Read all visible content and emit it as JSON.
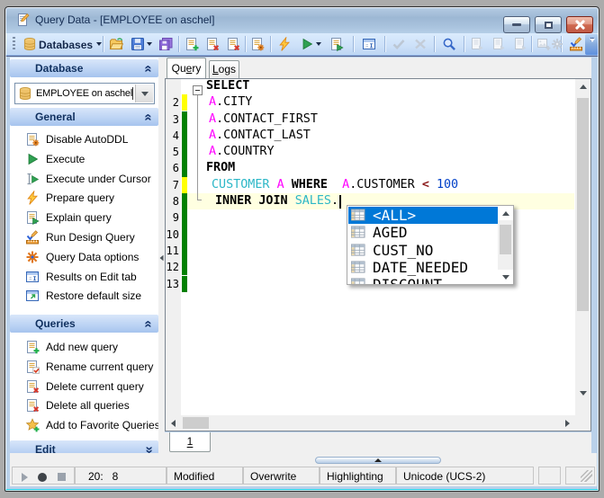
{
  "window": {
    "title": "Query Data - [EMPLOYEE on aschel]"
  },
  "toolbar": {
    "databases_label": "Databases",
    "items": [
      {
        "name": "databases-menu",
        "grayed": false
      },
      {
        "name": "open-query",
        "grayed": false
      },
      {
        "name": "save-query",
        "grayed": false
      },
      {
        "name": "save-all",
        "grayed": false
      },
      {
        "name": "new-query",
        "grayed": false
      },
      {
        "name": "delete-query",
        "grayed": false
      },
      {
        "name": "delete-all-queries",
        "grayed": false
      },
      {
        "name": "query-data-options",
        "grayed": false
      },
      {
        "name": "prepare-query",
        "grayed": false
      },
      {
        "name": "execute",
        "grayed": false
      },
      {
        "name": "explain-query",
        "grayed": false
      },
      {
        "name": "results-on-edit-tab",
        "grayed": false
      },
      {
        "name": "commit-transaction",
        "grayed": true
      },
      {
        "name": "rollback-transaction",
        "grayed": true
      },
      {
        "name": "find",
        "grayed": false
      },
      {
        "name": "export-data",
        "grayed": true
      },
      {
        "name": "export-as-insert",
        "grayed": true
      },
      {
        "name": "copy-results",
        "grayed": true
      },
      {
        "name": "add-image",
        "grayed": true
      },
      {
        "name": "settings",
        "grayed": true
      },
      {
        "name": "run-design-query",
        "grayed": false
      },
      {
        "name": "toolbar-overflow",
        "grayed": false
      }
    ]
  },
  "sidebar": {
    "groups": [
      {
        "title": "Database",
        "collapsed": false
      },
      {
        "title": "General",
        "collapsed": false
      },
      {
        "title": "Queries",
        "collapsed": false
      },
      {
        "title": "Edit",
        "collapsed": true
      }
    ],
    "database_combo": {
      "value": "EMPLOYEE on aschel"
    },
    "general_items": [
      {
        "icon": "doc-gear",
        "label": "Disable AutoDDL"
      },
      {
        "icon": "play",
        "label": "Execute"
      },
      {
        "icon": "exec-cursor",
        "label": "Execute under Cursor"
      },
      {
        "icon": "lightning",
        "label": "Prepare query"
      },
      {
        "icon": "doc-play",
        "label": "Explain query"
      },
      {
        "icon": "design",
        "label": "Run Design Query"
      },
      {
        "icon": "gear-color",
        "label": "Query Data options"
      },
      {
        "icon": "window-results",
        "label": "Results on Edit tab"
      },
      {
        "icon": "window-restore",
        "label": "Restore default size"
      }
    ],
    "queries_items": [
      {
        "icon": "doc-plus",
        "label": "Add new query"
      },
      {
        "icon": "doc-check",
        "label": "Rename current query"
      },
      {
        "icon": "doc-x",
        "label": "Delete current query"
      },
      {
        "icon": "doc-x",
        "label": "Delete all queries"
      },
      {
        "icon": "star-plus",
        "label": "Add to Favorite Queries"
      }
    ]
  },
  "editor": {
    "tabs": [
      {
        "label": "Query",
        "accel": 2,
        "active": true
      },
      {
        "label": "Logs",
        "accel": 0,
        "active": false
      }
    ],
    "page_tab": "1",
    "lines": [
      {
        "n": "",
        "bar": null,
        "fold": true,
        "pad": 21,
        "segs": [
          [
            "kw",
            "SELECT"
          ]
        ]
      },
      {
        "n": "2",
        "bar": "yellow",
        "pad": 24,
        "segs": [
          [
            "alias",
            "A"
          ],
          [
            "pl",
            ".CITY"
          ]
        ]
      },
      {
        "n": "3",
        "bar": "green",
        "pad": 24,
        "segs": [
          [
            "alias",
            "A"
          ],
          [
            "pl",
            ".CONTACT_FIRST"
          ]
        ]
      },
      {
        "n": "4",
        "bar": "green",
        "pad": 24,
        "segs": [
          [
            "alias",
            "A"
          ],
          [
            "pl",
            ".CONTACT_LAST"
          ]
        ]
      },
      {
        "n": "5",
        "bar": "green",
        "pad": 24,
        "segs": [
          [
            "alias",
            "A"
          ],
          [
            "pl",
            ".COUNTRY"
          ]
        ]
      },
      {
        "n": "6",
        "bar": "green",
        "pad": 21,
        "segs": [
          [
            "kw",
            "FROM"
          ]
        ]
      },
      {
        "n": "7",
        "bar": "yellow",
        "pad": 27,
        "segs": [
          [
            "tbl",
            "CUSTOMER"
          ],
          [
            "pl",
            " "
          ],
          [
            "alias",
            "A"
          ],
          [
            "pl",
            " "
          ],
          [
            "kw",
            "WHERE"
          ],
          [
            "pl",
            "  "
          ],
          [
            "alias",
            "A"
          ],
          [
            "pl",
            ".CUSTOMER "
          ],
          [
            "op",
            "<"
          ],
          [
            "pl",
            " "
          ],
          [
            "num",
            "100"
          ]
        ]
      },
      {
        "n": "8",
        "bar": "green",
        "pad": 31,
        "current": true,
        "caret": true,
        "segs": [
          [
            "kw",
            "INNER"
          ],
          [
            "pl",
            " "
          ],
          [
            "kw",
            "JOIN"
          ],
          [
            "pl",
            " "
          ],
          [
            "tbl",
            "SALES"
          ],
          [
            "pl",
            "."
          ]
        ]
      },
      {
        "n": "9",
        "bar": "green",
        "pad": 0,
        "segs": []
      },
      {
        "n": "10",
        "bar": "green",
        "pad": 0,
        "segs": []
      },
      {
        "n": "11",
        "bar": "green",
        "pad": 0,
        "segs": []
      },
      {
        "n": "12",
        "bar": "green",
        "pad": 0,
        "segs": []
      },
      {
        "n": "13",
        "bar": "green",
        "pad": 0,
        "segs": []
      }
    ],
    "bar_colors": {
      "yellow": "#ffff00",
      "green": "#008000"
    }
  },
  "autocomplete": {
    "items": [
      "<ALL>",
      "AGED",
      "CUST_NO",
      "DATE_NEEDED",
      "DISCOUNT"
    ],
    "selected_index": 0
  },
  "statusbar": {
    "position": "20:   8",
    "modified": "Modified",
    "mode": "Overwrite",
    "highlight": "Highlighting",
    "encoding": "Unicode (UCS-2)"
  }
}
